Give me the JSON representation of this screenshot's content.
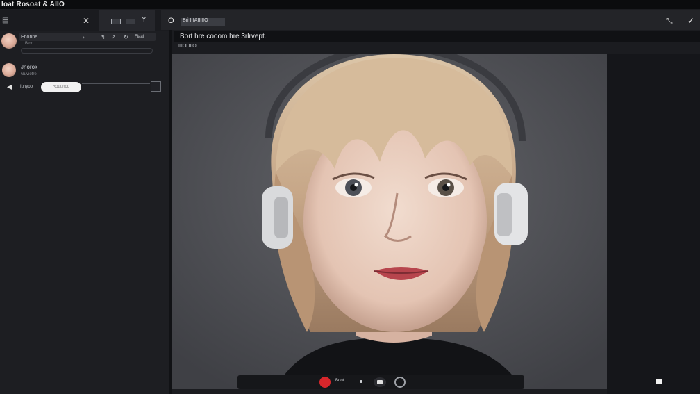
{
  "window": {
    "title": "Ioat Rosoat & AIIO"
  },
  "left_panel": {
    "top_icon": "▤",
    "close_icon": "✕",
    "filter_icon": "Y",
    "contacts": [
      {
        "name": "Enonne",
        "sub": "Bioo",
        "tag": "Fiaal"
      },
      {
        "name": "Jnorok",
        "sub": "Guviotre"
      }
    ],
    "input": {
      "label": "Iunyoo",
      "placeholder": "Rouunod"
    }
  },
  "main": {
    "back_icon": "O",
    "badge": "Bri IrIAIIIIIO",
    "caption": "Bort hre cooom hre 3rlrvept.",
    "sublabel": "IIIODIIO",
    "call_label": "Boot"
  },
  "colors": {
    "end_call": "#d8262b",
    "accent_bg": "#1b1c20"
  }
}
